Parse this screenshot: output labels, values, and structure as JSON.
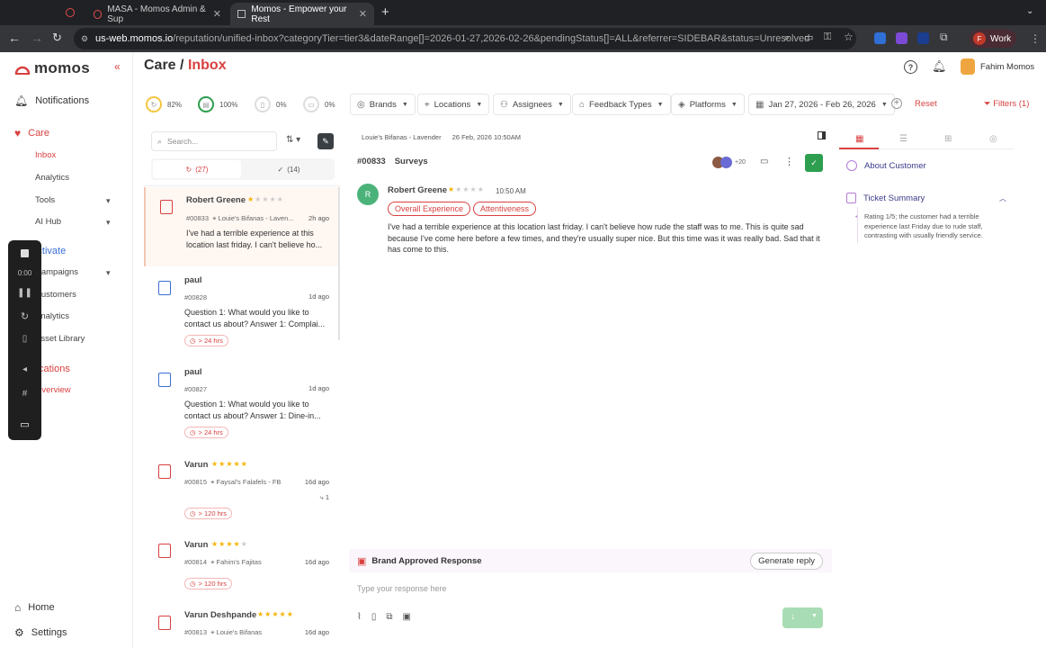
{
  "browser": {
    "tabs": [
      {
        "title": "MASA - Momos Admin & Sup"
      },
      {
        "title": "Momos - Empower your Rest"
      }
    ],
    "url_host": "us-web.momos.io",
    "url_path": "/reputation/unified-inbox?categoryTier=tier3&dateRange[]=2026-01-27,2026-02-26&pendingStatus[]=ALL&referrer=SIDEBAR&status=Unresolved",
    "profile_initial": "F",
    "profile_label": "Work"
  },
  "sidebar": {
    "logo": "momos",
    "collapse": "«",
    "notifications": "Notifications",
    "care": "Care",
    "care_items": [
      "Inbox",
      "Analytics",
      "Tools",
      "AI Hub"
    ],
    "activate": "Activate",
    "activate_items": [
      "Campaigns",
      "Customers",
      "Analytics",
      "Asset Library"
    ],
    "locations": "Locations",
    "locations_items": [
      "Overview"
    ],
    "home": "Home",
    "settings": "Settings"
  },
  "recorder": {
    "time": "0:00"
  },
  "header": {
    "section": "Care",
    "separator": "/",
    "page": "Inbox",
    "user": "Fahim Momos"
  },
  "stats": [
    "82%",
    "100%",
    "0%",
    "0%"
  ],
  "filters": {
    "brands": "Brands",
    "locations": "Locations",
    "assignees": "Assignees",
    "feedback_types": "Feedback Types",
    "platforms": "Platforms",
    "date_range": "Jan 27, 2026 - Feb 26, 2026",
    "reset": "Reset",
    "filters": "Filters (1)"
  },
  "list": {
    "search_placeholder": "Search...",
    "tab_open": "(27)",
    "tab_done": "(14)",
    "tickets": [
      {
        "name": "Robert Greene",
        "stars": 1,
        "id": "#00833",
        "location": "Louie's Bifanas - Laven...",
        "ago": "2h ago",
        "text": "I've had a terrible experience at this location last friday. I can't believe ho...",
        "sla": ""
      },
      {
        "name": "paul",
        "stars": 0,
        "id": "#00828",
        "location": "",
        "ago": "1d ago",
        "text": "Question 1: What would you like to contact us about? Answer 1: Complai...",
        "sla": "> 24 hrs"
      },
      {
        "name": "paul",
        "stars": 0,
        "id": "#00827",
        "location": "",
        "ago": "1d ago",
        "text": "Question 1: What would you like to contact us about? Answer 1: Dine-in...",
        "sla": "> 24 hrs"
      },
      {
        "name": "Varun",
        "stars": 5,
        "id": "#00815",
        "location": "Faysal's Falafels - FB",
        "ago": "16d ago",
        "text": "",
        "sla": "> 120 hrs",
        "replies": "1"
      },
      {
        "name": "Varun",
        "stars": 4,
        "id": "#00814",
        "location": "Fahim's Fajitas",
        "ago": "16d ago",
        "text": "",
        "sla": "> 120 hrs"
      },
      {
        "name": "Varun Deshpande",
        "stars": 5,
        "id": "#00813",
        "location": "Louie's Bifanas",
        "ago": "16d ago",
        "text": "",
        "sla": ""
      }
    ]
  },
  "conversation": {
    "location": "Louie's Bifanas - Lavender",
    "datetime": "26 Feb, 2026 10:50AM",
    "ticket_id": "#00833",
    "ticket_type": "Surveys",
    "avatar_count": "+20",
    "message": {
      "avatar": "R",
      "name": "Robert Greene",
      "stars": 1,
      "time": "10:50 AM",
      "tags": [
        "Overall Experience",
        "Attentiveness"
      ],
      "body": "I've had a terrible experience at this location last friday. I can't believe how rude the staff was to me. This is quite sad because I've come here before a few times, and they're usually super nice. But this time was it was really bad. Sad that it has come to this."
    },
    "brand_approved": "Brand Approved Response",
    "generate_reply": "Generate reply",
    "reply_placeholder": "Type your response here"
  },
  "right_panel": {
    "about": "About Customer",
    "summary_title": "Ticket Summary",
    "summary": "Rating 1/5; the customer had a terrible experience last Friday due to rude staff, contrasting with usually friendly service."
  },
  "colors": {
    "brand_red": "#d94040",
    "success_green": "#2e9e4f",
    "star": "#f5b400"
  }
}
